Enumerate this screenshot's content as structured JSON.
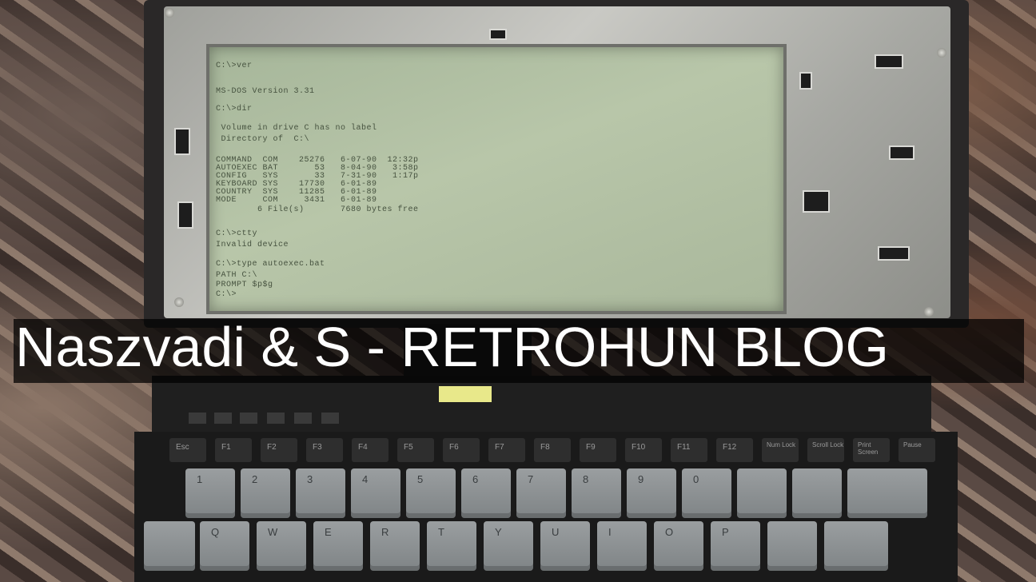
{
  "banner": {
    "title": "Naszvadi & S - RETROHUN BLOG"
  },
  "screen": {
    "lines": [
      "C:\\>ver",
      "MS-DOS Version 3.31",
      "C:\\>dir",
      " Volume in drive C has no label",
      " Directory of  C:\\",
      "COMMAND  COM    25276   6-07-90  12:32p",
      "AUTOEXEC BAT       53   8-04-90   3:58p",
      "CONFIG   SYS       33   7-31-90   1:17p",
      "KEYBOARD SYS    17730   6-01-89",
      "COUNTRY  SYS    11285   6-01-89",
      "MODE     COM     3431   6-01-89",
      "        6 File(s)       7680 bytes free",
      "C:\\>ctty",
      "Invalid device",
      "C:\\>type autoexec.bat",
      "PATH C:\\",
      "PROMPT $p$g",
      "C:\\>"
    ]
  },
  "keyboard": {
    "fkeys": [
      "Esc",
      "F1",
      "F2",
      "F3",
      "F4",
      "F5",
      "F6",
      "F7",
      "F8",
      "F9",
      "F10",
      "F11",
      "F12",
      "Num Lock",
      "Scroll Lock",
      "Print Screen",
      "Pause"
    ],
    "number_row": [
      "1",
      "2",
      "3",
      "4",
      "5",
      "6",
      "7",
      "8",
      "9",
      "0",
      "",
      "",
      ""
    ],
    "qwerty_row": [
      "",
      "Q",
      "W",
      "E",
      "R",
      "T",
      "Y",
      "U",
      "I",
      "O",
      "P",
      "",
      ""
    ]
  },
  "colors": {
    "lcd": "#b8c6a9",
    "lcd_text": "#46523f",
    "latch": "#e8e88a",
    "banner_bg": "#000000",
    "banner_text": "#ffffff"
  }
}
